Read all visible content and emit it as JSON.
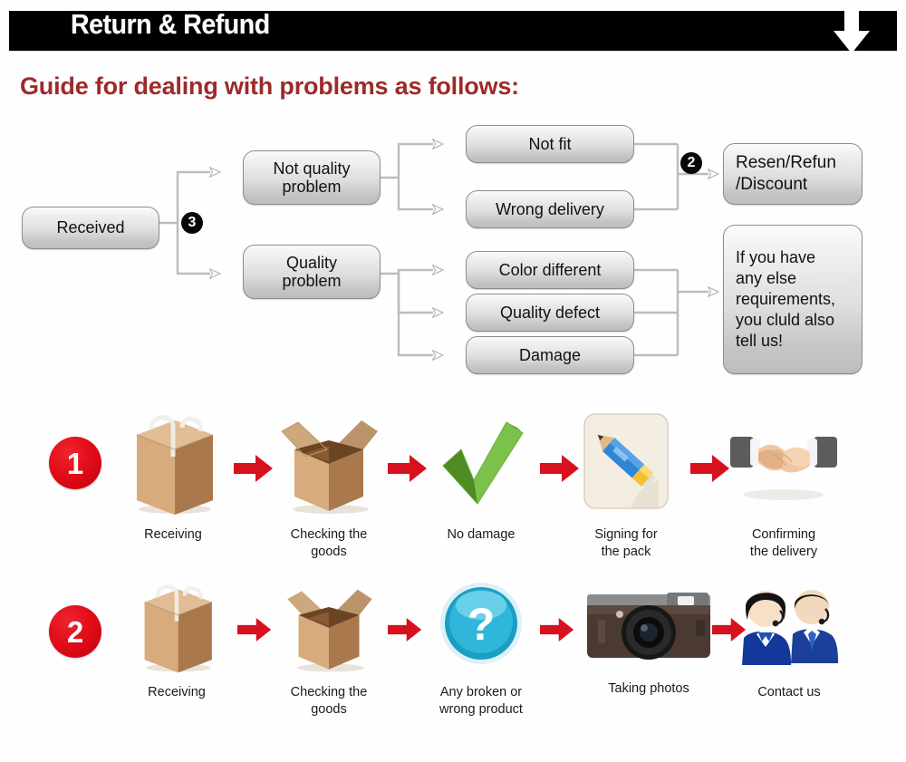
{
  "header": {
    "title": "Return & Refund",
    "down_arrow_icon": "arrow-down-icon",
    "bar_color": "#000000",
    "text_color": "#ffffff"
  },
  "guide": {
    "title": "Guide for dealing with problems as follows:",
    "color": "#9e2a2a"
  },
  "flowchart": {
    "badges": [
      {
        "id": "badge-3",
        "label": "3"
      },
      {
        "id": "badge-2",
        "label": "2"
      }
    ],
    "nodes": [
      {
        "id": "received",
        "label": "Received"
      },
      {
        "id": "not-quality-problem",
        "label": "Not quality\nproblem"
      },
      {
        "id": "quality-problem",
        "label": "Quality\nproblem"
      },
      {
        "id": "not-fit",
        "label": "Not fit"
      },
      {
        "id": "wrong-delivery",
        "label": "Wrong delivery"
      },
      {
        "id": "color-different",
        "label": "Color different"
      },
      {
        "id": "quality-defect",
        "label": "Quality defect"
      },
      {
        "id": "damage",
        "label": "Damage"
      },
      {
        "id": "resend-refund-discount",
        "label": "Resen/Refun\n/Discount"
      },
      {
        "id": "any-else-requirements",
        "label": "If you have\nany else\nrequirements,\nyou cluld also\ntell us!"
      }
    ],
    "connector_color": "#b8b8b8"
  },
  "process_rows": [
    {
      "number": "1",
      "steps": [
        {
          "icon": "sealed-box-icon",
          "label": "Receiving"
        },
        {
          "icon": "open-box-icon",
          "label": "Checking the\ngoods"
        },
        {
          "icon": "green-check-icon",
          "label": "No damage"
        },
        {
          "icon": "pencil-sign-icon",
          "label": "Signing for\nthe pack"
        },
        {
          "icon": "handshake-icon",
          "label": "Confirming\nthe delivery"
        }
      ]
    },
    {
      "number": "2",
      "steps": [
        {
          "icon": "sealed-box-icon",
          "label": "Receiving"
        },
        {
          "icon": "open-box-icon",
          "label": "Checking the\ngoods"
        },
        {
          "icon": "question-mark-icon",
          "label": "Any broken or\nwrong product"
        },
        {
          "icon": "camera-icon",
          "label": "Taking photos"
        },
        {
          "icon": "support-agents-icon",
          "label": "Contact us"
        }
      ]
    }
  ],
  "colors": {
    "red_accent": "#e00c18",
    "dark_red": "#9e2a2a",
    "node_border": "#8d8d8d"
  }
}
